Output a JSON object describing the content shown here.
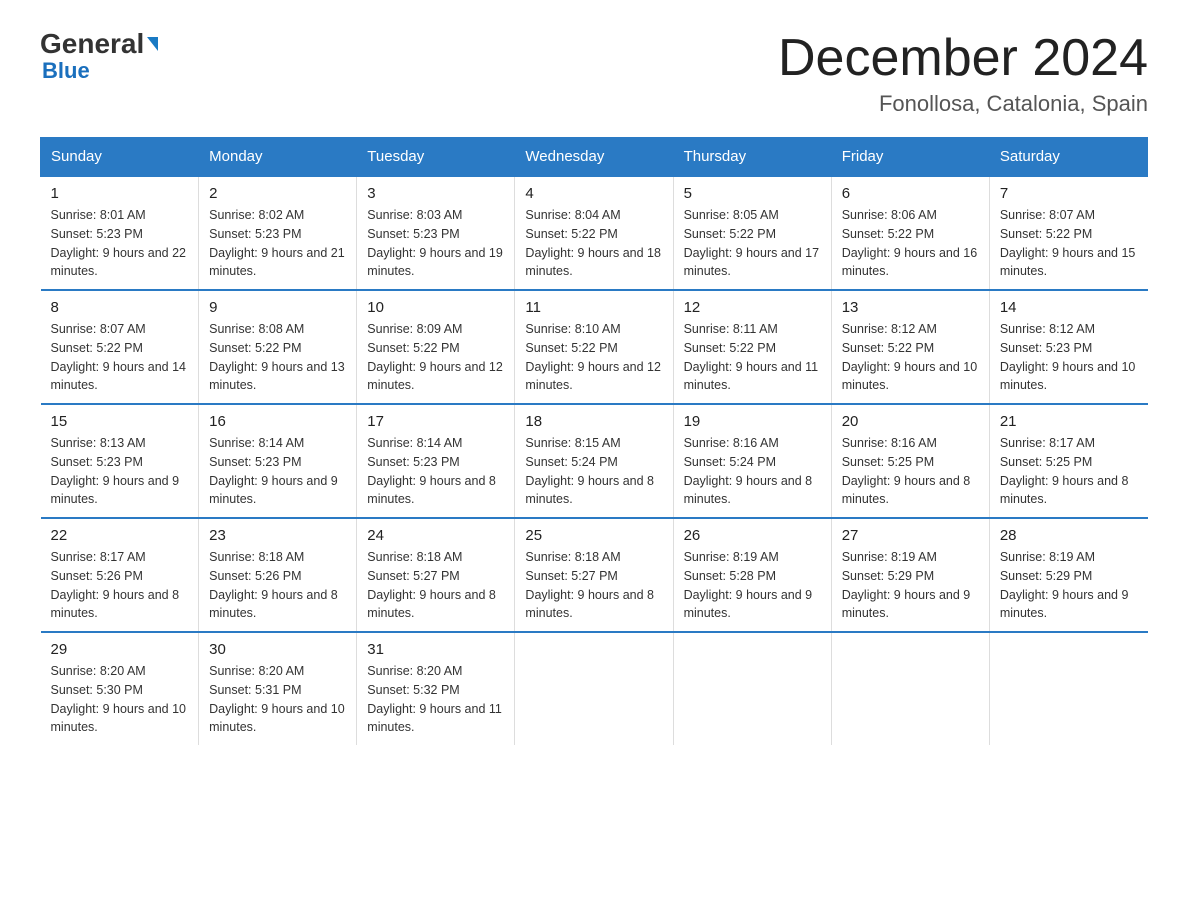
{
  "logo": {
    "general": "General",
    "blue": "Blue",
    "arrow": "▶"
  },
  "title": "December 2024",
  "subtitle": "Fonollosa, Catalonia, Spain",
  "days_of_week": [
    "Sunday",
    "Monday",
    "Tuesday",
    "Wednesday",
    "Thursday",
    "Friday",
    "Saturday"
  ],
  "weeks": [
    [
      {
        "day": "1",
        "sunrise": "8:01 AM",
        "sunset": "5:23 PM",
        "daylight": "9 hours and 22 minutes."
      },
      {
        "day": "2",
        "sunrise": "8:02 AM",
        "sunset": "5:23 PM",
        "daylight": "9 hours and 21 minutes."
      },
      {
        "day": "3",
        "sunrise": "8:03 AM",
        "sunset": "5:23 PM",
        "daylight": "9 hours and 19 minutes."
      },
      {
        "day": "4",
        "sunrise": "8:04 AM",
        "sunset": "5:22 PM",
        "daylight": "9 hours and 18 minutes."
      },
      {
        "day": "5",
        "sunrise": "8:05 AM",
        "sunset": "5:22 PM",
        "daylight": "9 hours and 17 minutes."
      },
      {
        "day": "6",
        "sunrise": "8:06 AM",
        "sunset": "5:22 PM",
        "daylight": "9 hours and 16 minutes."
      },
      {
        "day": "7",
        "sunrise": "8:07 AM",
        "sunset": "5:22 PM",
        "daylight": "9 hours and 15 minutes."
      }
    ],
    [
      {
        "day": "8",
        "sunrise": "8:07 AM",
        "sunset": "5:22 PM",
        "daylight": "9 hours and 14 minutes."
      },
      {
        "day": "9",
        "sunrise": "8:08 AM",
        "sunset": "5:22 PM",
        "daylight": "9 hours and 13 minutes."
      },
      {
        "day": "10",
        "sunrise": "8:09 AM",
        "sunset": "5:22 PM",
        "daylight": "9 hours and 12 minutes."
      },
      {
        "day": "11",
        "sunrise": "8:10 AM",
        "sunset": "5:22 PM",
        "daylight": "9 hours and 12 minutes."
      },
      {
        "day": "12",
        "sunrise": "8:11 AM",
        "sunset": "5:22 PM",
        "daylight": "9 hours and 11 minutes."
      },
      {
        "day": "13",
        "sunrise": "8:12 AM",
        "sunset": "5:22 PM",
        "daylight": "9 hours and 10 minutes."
      },
      {
        "day": "14",
        "sunrise": "8:12 AM",
        "sunset": "5:23 PM",
        "daylight": "9 hours and 10 minutes."
      }
    ],
    [
      {
        "day": "15",
        "sunrise": "8:13 AM",
        "sunset": "5:23 PM",
        "daylight": "9 hours and 9 minutes."
      },
      {
        "day": "16",
        "sunrise": "8:14 AM",
        "sunset": "5:23 PM",
        "daylight": "9 hours and 9 minutes."
      },
      {
        "day": "17",
        "sunrise": "8:14 AM",
        "sunset": "5:23 PM",
        "daylight": "9 hours and 8 minutes."
      },
      {
        "day": "18",
        "sunrise": "8:15 AM",
        "sunset": "5:24 PM",
        "daylight": "9 hours and 8 minutes."
      },
      {
        "day": "19",
        "sunrise": "8:16 AM",
        "sunset": "5:24 PM",
        "daylight": "9 hours and 8 minutes."
      },
      {
        "day": "20",
        "sunrise": "8:16 AM",
        "sunset": "5:25 PM",
        "daylight": "9 hours and 8 minutes."
      },
      {
        "day": "21",
        "sunrise": "8:17 AM",
        "sunset": "5:25 PM",
        "daylight": "9 hours and 8 minutes."
      }
    ],
    [
      {
        "day": "22",
        "sunrise": "8:17 AM",
        "sunset": "5:26 PM",
        "daylight": "9 hours and 8 minutes."
      },
      {
        "day": "23",
        "sunrise": "8:18 AM",
        "sunset": "5:26 PM",
        "daylight": "9 hours and 8 minutes."
      },
      {
        "day": "24",
        "sunrise": "8:18 AM",
        "sunset": "5:27 PM",
        "daylight": "9 hours and 8 minutes."
      },
      {
        "day": "25",
        "sunrise": "8:18 AM",
        "sunset": "5:27 PM",
        "daylight": "9 hours and 8 minutes."
      },
      {
        "day": "26",
        "sunrise": "8:19 AM",
        "sunset": "5:28 PM",
        "daylight": "9 hours and 9 minutes."
      },
      {
        "day": "27",
        "sunrise": "8:19 AM",
        "sunset": "5:29 PM",
        "daylight": "9 hours and 9 minutes."
      },
      {
        "day": "28",
        "sunrise": "8:19 AM",
        "sunset": "5:29 PM",
        "daylight": "9 hours and 9 minutes."
      }
    ],
    [
      {
        "day": "29",
        "sunrise": "8:20 AM",
        "sunset": "5:30 PM",
        "daylight": "9 hours and 10 minutes."
      },
      {
        "day": "30",
        "sunrise": "8:20 AM",
        "sunset": "5:31 PM",
        "daylight": "9 hours and 10 minutes."
      },
      {
        "day": "31",
        "sunrise": "8:20 AM",
        "sunset": "5:32 PM",
        "daylight": "9 hours and 11 minutes."
      },
      null,
      null,
      null,
      null
    ]
  ]
}
